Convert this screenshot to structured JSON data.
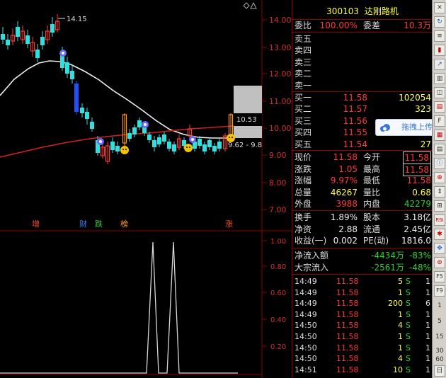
{
  "chart": {
    "price_axis": [
      "14.00",
      "13.00",
      "12.00",
      "11.00",
      "10.00",
      "9.00",
      "8.00",
      "7.00"
    ],
    "high_label": "14.15",
    "label_top": "10.53",
    "label_bottom": "9.62 - 9.8",
    "events": [
      {
        "text": "增",
        "color": "#ff5030"
      },
      {
        "text": "财",
        "color": "#4080ff"
      },
      {
        "text": "跌",
        "color": "#28d228"
      },
      {
        "text": "榜",
        "color": "#ff9a30"
      },
      {
        "text": "涨",
        "color": "#ff5030"
      }
    ],
    "indicator_axis": [
      "1.00",
      "0.80",
      "0.60",
      "0.40",
      "0.20"
    ]
  },
  "colors": {
    "up": "#ff3838",
    "down": "#30e0e0",
    "solid_down": "#2050ff",
    "ma_white": "#f0f0f0",
    "ma_red": "#d02020"
  },
  "header": {
    "code": "300103",
    "name": "达刚路机"
  },
  "order": {
    "wb_label": "委比",
    "wb_value": "100.00%",
    "wc_label": "委差",
    "wc_value": "10.3万"
  },
  "asks": [
    {
      "label": "卖五",
      "price": "",
      "vol": ""
    },
    {
      "label": "卖四",
      "price": "",
      "vol": ""
    },
    {
      "label": "卖三",
      "price": "",
      "vol": ""
    },
    {
      "label": "卖二",
      "price": "",
      "vol": ""
    },
    {
      "label": "卖一",
      "price": "",
      "vol": ""
    }
  ],
  "bids": [
    {
      "label": "买一",
      "price": "11.58",
      "vol": "102054"
    },
    {
      "label": "买二",
      "price": "11.57",
      "vol": "323"
    },
    {
      "label": "买三",
      "price": "11.56",
      "vol": ""
    },
    {
      "label": "买四",
      "price": "11.55",
      "vol": ""
    },
    {
      "label": "买五",
      "price": "11.54",
      "vol": "27"
    }
  ],
  "quote": [
    {
      "l1": "现价",
      "v1": "11.58",
      "c1": "red",
      "l2": "今开",
      "v2": "11.58",
      "c2": "red",
      "box": true
    },
    {
      "l1": "涨跌",
      "v1": "1.05",
      "c1": "red",
      "l2": "最高",
      "v2": "11.58",
      "c2": "red",
      "box": true
    },
    {
      "l1": "涨幅",
      "v1": "9.97%",
      "c1": "red",
      "l2": "最低",
      "v2": "11.58",
      "c2": "red",
      "box": false
    },
    {
      "l1": "总量",
      "v1": "46267",
      "c1": "yellow",
      "l2": "量比",
      "v2": "0.68",
      "c2": "yellow",
      "box": false
    },
    {
      "l1": "外盘",
      "v1": "3988",
      "c1": "red",
      "l2": "内盘",
      "v2": "42279",
      "c2": "green",
      "box": false
    }
  ],
  "stats": [
    {
      "l1": "换手",
      "v1": "1.89%",
      "l2": "股本",
      "v2": "3.18亿"
    },
    {
      "l1": "净资",
      "v1": "2.88",
      "l2": "流通",
      "v2": "2.45亿"
    },
    {
      "l1": "收益(一)",
      "v1": "0.002",
      "l2": "PE(动)",
      "v2": "1816.0"
    }
  ],
  "flow": [
    {
      "label": "净流入额",
      "value": "-4434万",
      "pct": "-83%"
    },
    {
      "label": "大宗流入",
      "value": "-2561万",
      "pct": "-48%"
    }
  ],
  "ticks": [
    {
      "time": "14:49",
      "price": "11.58",
      "vol": "5",
      "bs": "S",
      "n": "1"
    },
    {
      "time": "14:49",
      "price": "11.58",
      "vol": "1",
      "bs": "S",
      "n": "1"
    },
    {
      "time": "14:49",
      "price": "11.58",
      "vol": "200",
      "bs": "S",
      "n": "6"
    },
    {
      "time": "14:49",
      "price": "11.58",
      "vol": "1",
      "bs": "S",
      "n": "1"
    },
    {
      "time": "14:50",
      "price": "11.58",
      "vol": "4",
      "bs": "S",
      "n": "1"
    },
    {
      "time": "14:50",
      "price": "11.58",
      "vol": "1",
      "bs": "S",
      "n": "1"
    },
    {
      "time": "14:50",
      "price": "11.58",
      "vol": "1",
      "bs": "S",
      "n": "1"
    },
    {
      "time": "14:50",
      "price": "11.58",
      "vol": "4",
      "bs": "S",
      "n": "1"
    },
    {
      "time": "14:51",
      "price": "11.58",
      "vol": "10",
      "bs": "S",
      "n": "1"
    }
  ],
  "tooltip": {
    "text": "拖拽上传"
  },
  "toolbar": {
    "rsi": "RSI",
    "f5": "F5",
    "f9": "F9",
    "n1": "1",
    "n5": "5",
    "n15": "15",
    "n30": "30",
    "n60": "60",
    "day": "日"
  }
}
